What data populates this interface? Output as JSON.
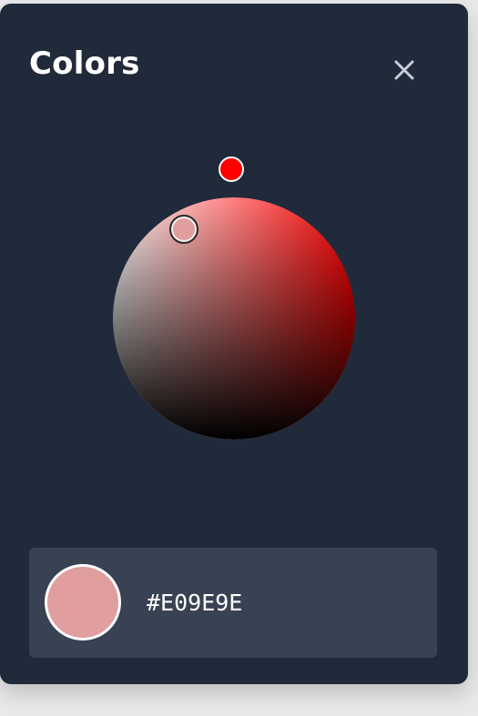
{
  "window": {
    "title": "Colors",
    "close_icon": "close-icon"
  },
  "picker": {
    "hue_color": "#FF0000",
    "selected_color": "#E09E9E",
    "hex_value": "#E09E9E"
  },
  "colors": {
    "panel_background": "#212A3A",
    "output_background": "#394253",
    "text": "#FFFFFF",
    "close_icon": "#C8CED8"
  }
}
